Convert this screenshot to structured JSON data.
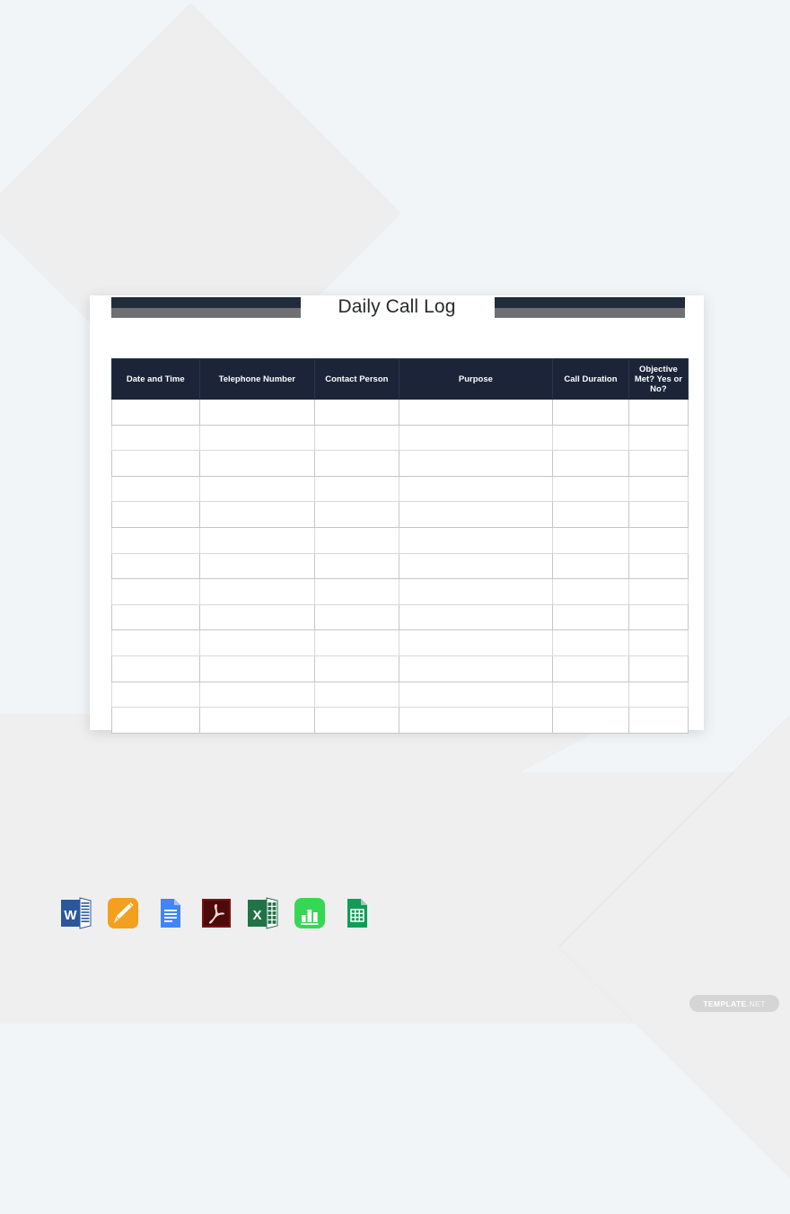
{
  "document": {
    "title": "Daily Call Log",
    "decorations": {
      "left_bar": {
        "top_color": "#222b3c",
        "bottom_color": "#6e7074"
      },
      "right_bar": {
        "top_color": "#222b3c",
        "bottom_color": "#6e7074"
      }
    }
  },
  "table": {
    "header_bg": "#1b2439",
    "header_text_color": "#ffffff",
    "columns": [
      {
        "label": "Date and Time",
        "width_pct": 15.2
      },
      {
        "label": "Telephone Number",
        "width_pct": 20.0
      },
      {
        "label": "Contact Person",
        "width_pct": 14.6
      },
      {
        "label": "Purpose",
        "width_pct": 26.7
      },
      {
        "label": "Call Duration",
        "width_pct": 13.2
      },
      {
        "label": "Objective Met? Yes or No?",
        "width_pct": 10.3
      }
    ],
    "row_count": 13,
    "rows": [
      [
        "",
        "",
        "",
        "",
        "",
        ""
      ],
      [
        "",
        "",
        "",
        "",
        "",
        ""
      ],
      [
        "",
        "",
        "",
        "",
        "",
        ""
      ],
      [
        "",
        "",
        "",
        "",
        "",
        ""
      ],
      [
        "",
        "",
        "",
        "",
        "",
        ""
      ],
      [
        "",
        "",
        "",
        "",
        "",
        ""
      ],
      [
        "",
        "",
        "",
        "",
        "",
        ""
      ],
      [
        "",
        "",
        "",
        "",
        "",
        ""
      ],
      [
        "",
        "",
        "",
        "",
        "",
        ""
      ],
      [
        "",
        "",
        "",
        "",
        "",
        ""
      ],
      [
        "",
        "",
        "",
        "",
        "",
        ""
      ],
      [
        "",
        "",
        "",
        "",
        "",
        ""
      ],
      [
        "",
        "",
        "",
        "",
        "",
        ""
      ]
    ]
  },
  "formats": {
    "icons": [
      {
        "name": "microsoft-word-icon",
        "label": "Word",
        "color": "#2b579a"
      },
      {
        "name": "apple-pages-icon",
        "label": "Pages",
        "color": "#f5a623"
      },
      {
        "name": "google-docs-icon",
        "label": "Google Docs",
        "color": "#4285f4"
      },
      {
        "name": "adobe-pdf-icon",
        "label": "PDF",
        "color": "#6e1414"
      },
      {
        "name": "microsoft-excel-icon",
        "label": "Excel",
        "color": "#217346"
      },
      {
        "name": "apple-numbers-icon",
        "label": "Numbers",
        "color": "#3ddc5b"
      },
      {
        "name": "google-sheets-icon",
        "label": "Google Sheets",
        "color": "#0f9d58"
      }
    ]
  },
  "watermark": {
    "primary": "TEMPLATE",
    "secondary": ".NET"
  }
}
